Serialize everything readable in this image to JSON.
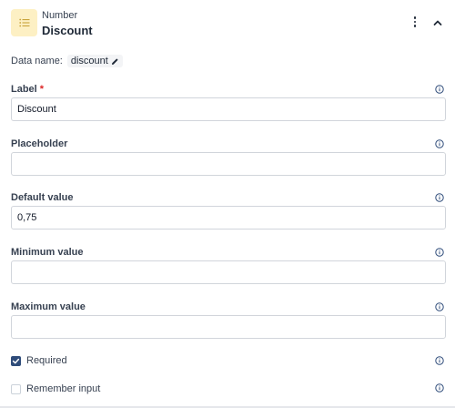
{
  "header": {
    "type_label": "Number",
    "title": "Discount",
    "type_icon": "list-icon",
    "menu_icon": "kebab-icon",
    "collapse_icon": "chevron-up-icon"
  },
  "data_name": {
    "label": "Data name:",
    "value": "discount",
    "edit_icon": "pencil-icon"
  },
  "fields": {
    "label": {
      "label": "Label",
      "required_mark": "*",
      "value": "Discount"
    },
    "placeholder": {
      "label": "Placeholder",
      "value": ""
    },
    "default_value": {
      "label": "Default value",
      "value": "0,75"
    },
    "minimum_value": {
      "label": "Minimum value",
      "value": ""
    },
    "maximum_value": {
      "label": "Maximum value",
      "value": ""
    }
  },
  "options": {
    "required": {
      "label": "Required",
      "checked": true
    },
    "remember_input": {
      "label": "Remember input",
      "checked": false
    }
  },
  "info_icon": "info-circle-icon",
  "colors": {
    "badge_bg": "#fdf0c4",
    "badge_icon": "#c9a33a",
    "checkbox_on": "#2f4c7a",
    "required_star": "#dc2626",
    "info_icon": "#2f4c7a"
  }
}
